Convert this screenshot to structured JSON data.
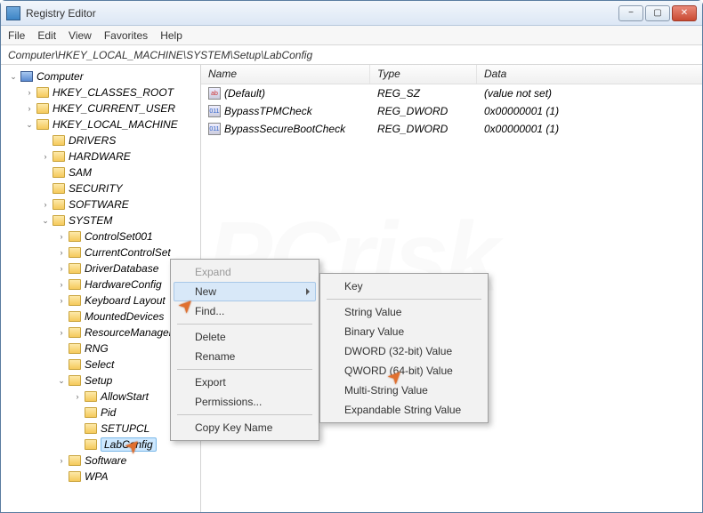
{
  "title": "Registry Editor",
  "menu": {
    "file": "File",
    "edit": "Edit",
    "view": "View",
    "favorites": "Favorites",
    "help": "Help"
  },
  "address": "Computer\\HKEY_LOCAL_MACHINE\\SYSTEM\\Setup\\LabConfig",
  "columns": {
    "name": "Name",
    "type": "Type",
    "data": "Data"
  },
  "values": [
    {
      "name": "(Default)",
      "type": "REG_SZ",
      "data": "(value not set)",
      "icon": "ab"
    },
    {
      "name": "BypassTPMCheck",
      "type": "REG_DWORD",
      "data": "0x00000001 (1)",
      "icon": "011"
    },
    {
      "name": "BypassSecureBootCheck",
      "type": "REG_DWORD",
      "data": "0x00000001 (1)",
      "icon": "011"
    }
  ],
  "tree_root": "Computer",
  "hives": [
    "HKEY_CLASSES_ROOT",
    "HKEY_CURRENT_USER",
    "HKEY_LOCAL_MACHINE"
  ],
  "hklm_children": [
    "DRIVERS",
    "HARDWARE",
    "SAM",
    "SECURITY",
    "SOFTWARE",
    "SYSTEM"
  ],
  "system_children": [
    "ControlSet001",
    "CurrentControlSet",
    "DriverDatabase",
    "HardwareConfig",
    "Keyboard Layout",
    "MountedDevices",
    "ResourceManager",
    "RNG",
    "Select",
    "Setup",
    "Software",
    "WPA"
  ],
  "setup_children": [
    "AllowStart",
    "Pid",
    "SETUPCL",
    "LabConfig"
  ],
  "ctx1": {
    "expand": "Expand",
    "new": "New",
    "find": "Find...",
    "delete": "Delete",
    "rename": "Rename",
    "export": "Export",
    "permissions": "Permissions...",
    "copy": "Copy Key Name"
  },
  "ctx2": {
    "key": "Key",
    "string": "String Value",
    "binary": "Binary Value",
    "dword": "DWORD (32-bit) Value",
    "qword": "QWORD (64-bit) Value",
    "multi": "Multi-String Value",
    "expand": "Expandable String Value"
  },
  "watermark": "PCrisk"
}
